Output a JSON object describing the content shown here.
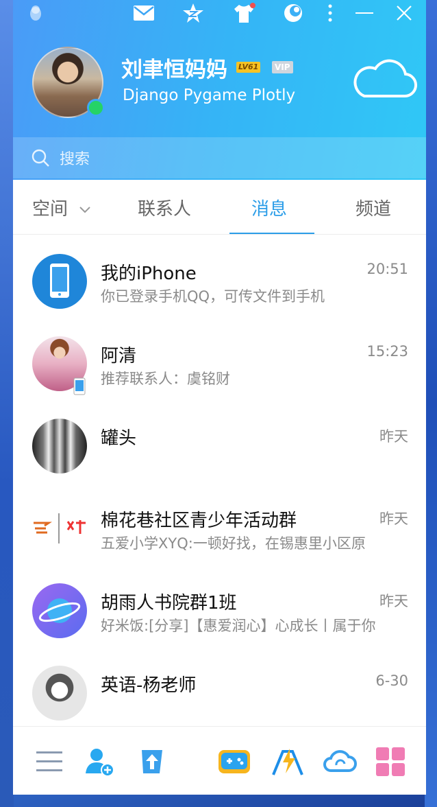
{
  "profile": {
    "nickname": "刘聿恒妈妈",
    "level_badge": "LV61",
    "vip_badge": "VIP",
    "signature": "Django Pygame Plotly",
    "status": "online"
  },
  "titlebar": {
    "icons": [
      "qq-penguin-icon",
      "mail-icon",
      "qzone-star-icon",
      "skin-shirt-icon",
      "theme-icon",
      "more-icon",
      "minimize-icon",
      "close-icon"
    ]
  },
  "search": {
    "placeholder": "搜索"
  },
  "tabs": [
    {
      "label": "空间"
    },
    {
      "label": "联系人"
    },
    {
      "label": "消息",
      "active": true
    },
    {
      "label": "频道"
    }
  ],
  "messages": [
    {
      "name": "我的iPhone",
      "preview": "你已登录手机QQ，可传文件到手机",
      "time": "20:51"
    },
    {
      "name": "阿清",
      "preview": "推荐联系人：虞铭财",
      "time": "15:23"
    },
    {
      "name": "罐头",
      "preview": "",
      "time": "昨天"
    },
    {
      "name": "棉花巷社区青少年活动群",
      "preview": "五爱小学XYQ:一顿好找，在锡惠里小区原",
      "time": "昨天"
    },
    {
      "name": "胡雨人书院群1班",
      "preview": "好米饭:[分享]【惠爱润心】心成长丨属于你",
      "time": "昨天"
    },
    {
      "name": "英语-杨老师",
      "preview": "",
      "time": "6-30"
    }
  ],
  "bottombar": {
    "icons": [
      "menu-icon",
      "add-friend-icon",
      "upload-icon",
      "game-center-icon",
      "qq-flash-icon",
      "weiyun-icon",
      "apps-grid-icon"
    ]
  },
  "colors": {
    "accent": "#2b9de8",
    "online": "#25d366",
    "header_start": "#4a9bf7",
    "header_end": "#30c8f6"
  }
}
